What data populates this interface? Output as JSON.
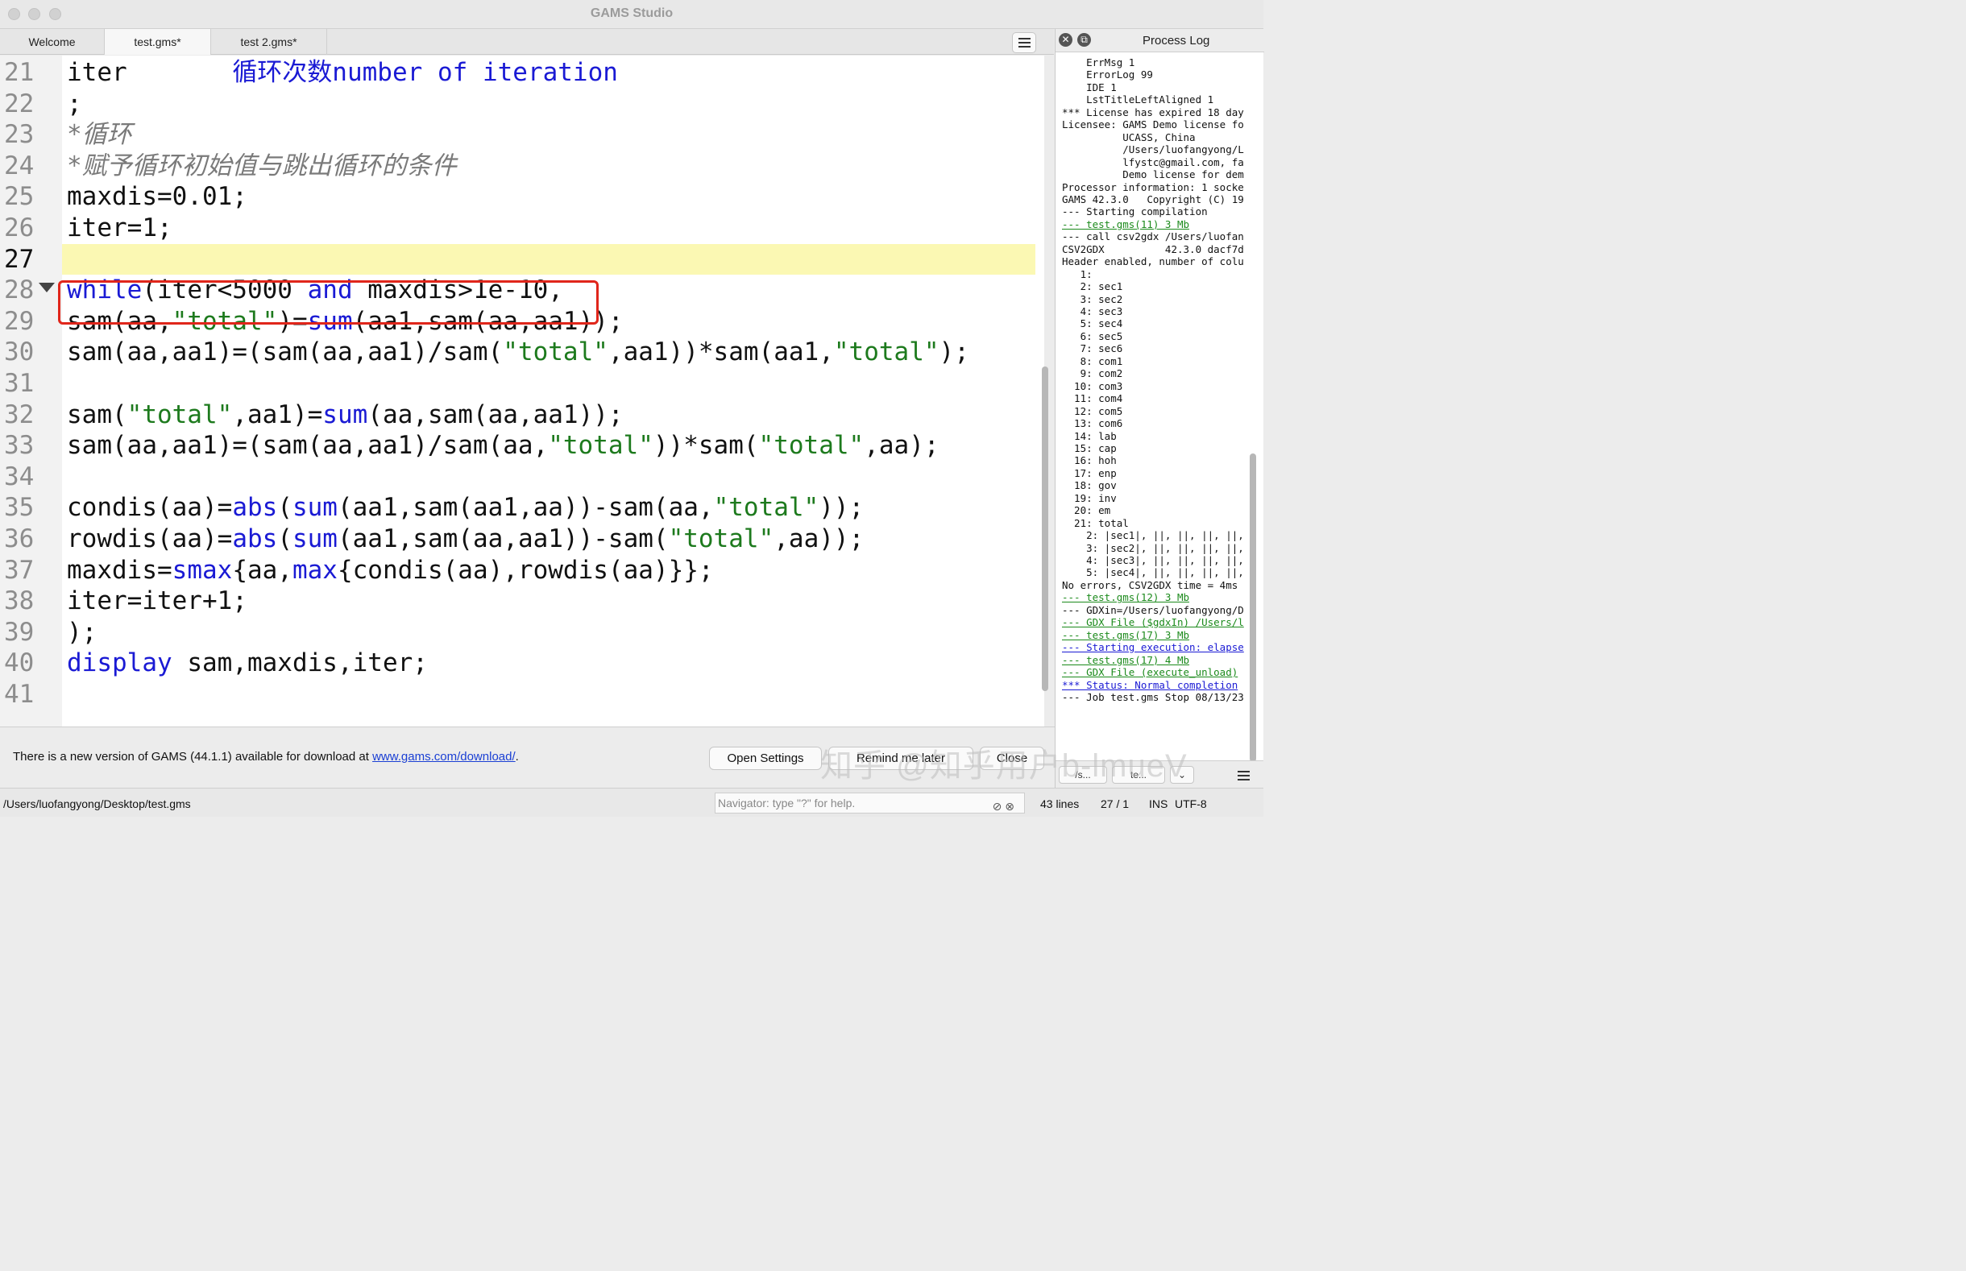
{
  "window": {
    "title": "GAMS Studio"
  },
  "tabs": [
    {
      "label": "Welcome"
    },
    {
      "label": "test.gms*"
    },
    {
      "label": "test 2.gms*"
    }
  ],
  "editor": {
    "lines": [
      {
        "num": "21",
        "html": "iter       <span class=\"kw\">循环次数number of iteration</span>"
      },
      {
        "num": "22",
        "html": ";"
      },
      {
        "num": "23",
        "html": "<span class=\"cmt\">*循环</span>"
      },
      {
        "num": "24",
        "html": "<span class=\"cmt\">*赋予循环初始值与跳出循环的条件</span>"
      },
      {
        "num": "25",
        "html": "maxdis=0.01;"
      },
      {
        "num": "26",
        "html": "iter=1;"
      },
      {
        "num": "27",
        "html": ""
      },
      {
        "num": "28",
        "html": "<span class=\"kw\">while</span>(iter&lt;5000 <span class=\"kw\">and</span> maxdis&gt;1e-10,"
      },
      {
        "num": "29",
        "html": "sam(aa,<span class=\"str\">\"total\"</span>)=<span class=\"kw\">sum</span>(aa1,sam(aa,aa1));"
      },
      {
        "num": "30",
        "html": "sam(aa,aa1)=(sam(aa,aa1)/sam(<span class=\"str\">\"total\"</span>,aa1))*sam(aa1,<span class=\"str\">\"total\"</span>);"
      },
      {
        "num": "31",
        "html": ""
      },
      {
        "num": "32",
        "html": "sam(<span class=\"str\">\"total\"</span>,aa1)=<span class=\"kw\">sum</span>(aa,sam(aa,aa1));"
      },
      {
        "num": "33",
        "html": "sam(aa,aa1)=(sam(aa,aa1)/sam(aa,<span class=\"str\">\"total\"</span>))*sam(<span class=\"str\">\"total\"</span>,aa);"
      },
      {
        "num": "34",
        "html": ""
      },
      {
        "num": "35",
        "html": "condis(aa)=<span class=\"kw\">abs</span>(<span class=\"kw\">sum</span>(aa1,sam(aa1,aa))-sam(aa,<span class=\"str\">\"total\"</span>));"
      },
      {
        "num": "36",
        "html": "rowdis(aa)=<span class=\"kw\">abs</span>(<span class=\"kw\">sum</span>(aa1,sam(aa,aa1))-sam(<span class=\"str\">\"total\"</span>,aa));"
      },
      {
        "num": "37",
        "html": "maxdis=<span class=\"kw\">smax</span>{aa,<span class=\"kw\">max</span>{condis(aa),rowdis(aa)}};"
      },
      {
        "num": "38",
        "html": "iter=iter+1;"
      },
      {
        "num": "39",
        "html": ");"
      },
      {
        "num": "40",
        "html": "<span class=\"kw\">display</span> sam,maxdis,iter;"
      },
      {
        "num": "41",
        "html": ""
      }
    ]
  },
  "process_log": {
    "title": "Process Log",
    "lines": [
      {
        "text": "    ErrMsg 1"
      },
      {
        "text": "    ErrorLog 99"
      },
      {
        "text": "    IDE 1"
      },
      {
        "text": "    LstTitleLeftAligned 1"
      },
      {
        "text": "*** License has expired 18 day"
      },
      {
        "text": "Licensee: GAMS Demo license fo"
      },
      {
        "text": "          UCASS, China"
      },
      {
        "text": "          /Users/luofangyong/L"
      },
      {
        "text": "          lfystc@gmail.com, fa"
      },
      {
        "text": "          Demo license for dem"
      },
      {
        "text": "Processor information: 1 socke"
      },
      {
        "text": "GAMS 42.3.0   Copyright (C) 19"
      },
      {
        "text": "--- Starting compilation"
      },
      {
        "text": "--- test.gms(11) 3 Mb",
        "link": "green"
      },
      {
        "text": "--- call csv2gdx /Users/luofan"
      },
      {
        "text": "CSV2GDX          42.3.0 dacf7d"
      },
      {
        "text": "Header enabled, number of colu"
      },
      {
        "text": "   1:"
      },
      {
        "text": "   2: sec1"
      },
      {
        "text": "   3: sec2"
      },
      {
        "text": "   4: sec3"
      },
      {
        "text": "   5: sec4"
      },
      {
        "text": "   6: sec5"
      },
      {
        "text": "   7: sec6"
      },
      {
        "text": "   8: com1"
      },
      {
        "text": "   9: com2"
      },
      {
        "text": "  10: com3"
      },
      {
        "text": "  11: com4"
      },
      {
        "text": "  12: com5"
      },
      {
        "text": "  13: com6"
      },
      {
        "text": "  14: lab"
      },
      {
        "text": "  15: cap"
      },
      {
        "text": "  16: hoh"
      },
      {
        "text": "  17: enp"
      },
      {
        "text": "  18: gov"
      },
      {
        "text": "  19: inv"
      },
      {
        "text": "  20: em"
      },
      {
        "text": "  21: total"
      },
      {
        "text": "    2: |sec1|, ||, ||, ||, ||,"
      },
      {
        "text": "    3: |sec2|, ||, ||, ||, ||,"
      },
      {
        "text": "    4: |sec3|, ||, ||, ||, ||,"
      },
      {
        "text": "    5: |sec4|, ||, ||, ||, ||,"
      },
      {
        "text": "No errors, CSV2GDX time = 4ms"
      },
      {
        "text": "--- test.gms(12) 3 Mb",
        "link": "green"
      },
      {
        "text": "--- GDXin=/Users/luofangyong/D"
      },
      {
        "text": "--- GDX File ($gdxIn) /Users/l",
        "link": "green"
      },
      {
        "text": "--- test.gms(17) 3 Mb",
        "link": "green"
      },
      {
        "text": "--- Starting execution: elapse",
        "link": "blue"
      },
      {
        "text": "--- test.gms(17) 4 Mb",
        "link": "green"
      },
      {
        "text": "--- GDX File (execute_unload)",
        "link": "green"
      },
      {
        "text": "*** Status: Normal completion",
        "link": "blue"
      },
      {
        "text": "--- Job test.gms Stop 08/13/23"
      }
    ],
    "bottom_left_label": "/s...",
    "bottom_mid_label": "te..."
  },
  "notice": {
    "text_before": "There is a new version of GAMS (44.1.1) available for download at ",
    "link": "www.gams.com/download/",
    "text_after": ".",
    "open_settings": "Open Settings",
    "remind_later": "Remind me later",
    "close": "Close"
  },
  "watermark": "知乎 @知乎用户b-lmueV",
  "statusbar": {
    "path": "/Users/luofangyong/Desktop/test.gms",
    "navigator_placeholder": "Navigator: type \"?\" for help.",
    "lines": "43 lines",
    "position": "27 / 1",
    "mode": "INS",
    "encoding": "UTF-8"
  },
  "current_line": "27"
}
